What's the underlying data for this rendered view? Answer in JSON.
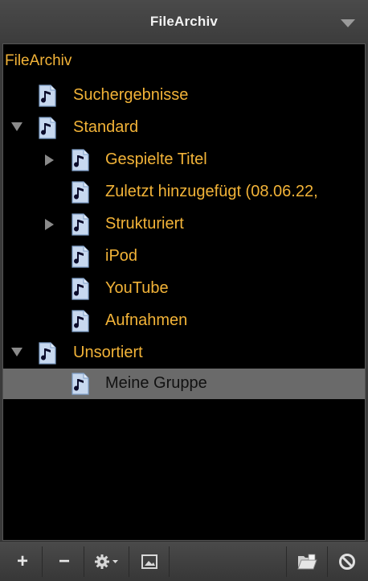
{
  "panel": {
    "title": "FileArchiv"
  },
  "tree": {
    "root_label": "FileArchiv",
    "items": [
      {
        "label": "Suchergebnisse",
        "level": 1,
        "disclosure": "none",
        "selected": false
      },
      {
        "label": "Standard",
        "level": 1,
        "disclosure": "expanded",
        "selected": false
      },
      {
        "label": "Gespielte Titel",
        "level": 2,
        "disclosure": "collapsed",
        "selected": false
      },
      {
        "label": "Zuletzt hinzugefügt (08.06.22,",
        "level": 2,
        "disclosure": "none",
        "selected": false
      },
      {
        "label": "Strukturiert",
        "level": 2,
        "disclosure": "collapsed",
        "selected": false
      },
      {
        "label": "iPod",
        "level": 2,
        "disclosure": "none",
        "selected": false
      },
      {
        "label": "YouTube",
        "level": 2,
        "disclosure": "none",
        "selected": false
      },
      {
        "label": "Aufnahmen",
        "level": 2,
        "disclosure": "none",
        "selected": false
      },
      {
        "label": "Unsortiert",
        "level": 1,
        "disclosure": "expanded",
        "selected": false
      },
      {
        "label": "Meine Gruppe",
        "level": 2,
        "disclosure": "none",
        "selected": true
      }
    ]
  },
  "toolbar": {
    "add_label": "+",
    "remove_label": "−",
    "buttons": [
      "add",
      "remove",
      "gear-menu",
      "image",
      "folder",
      "cancel"
    ]
  },
  "colors": {
    "text_gold": "#f2b338",
    "background": "#000000",
    "selected_row": "#6a6a6a",
    "chrome": "#3a3a3a"
  },
  "icons": {
    "item_icon": "music-note-document-icon",
    "menu": "triangle-down-icon"
  }
}
